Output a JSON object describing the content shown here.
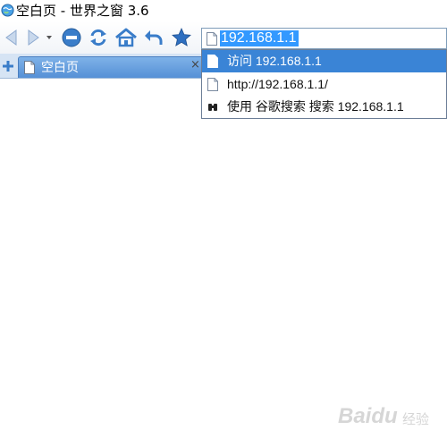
{
  "window": {
    "title": "空白页 - 世界之窗 3.6",
    "app_icon": "globe-icon"
  },
  "toolbar": {
    "buttons": [
      {
        "name": "back",
        "icon": "back-arrow-icon"
      },
      {
        "name": "forward",
        "icon": "forward-arrow-icon"
      },
      {
        "name": "history-dropdown",
        "icon": "chevron-down-icon"
      },
      {
        "name": "stop",
        "icon": "stop-icon"
      },
      {
        "name": "refresh",
        "icon": "refresh-icon"
      },
      {
        "name": "home",
        "icon": "home-icon"
      },
      {
        "name": "undo",
        "icon": "undo-arrow-icon"
      },
      {
        "name": "favorites",
        "icon": "star-icon"
      }
    ],
    "colors": {
      "icon_blue": "#3a7dc9",
      "star": "#2e6fc0"
    }
  },
  "address_bar": {
    "value": "192.168.1.1",
    "selected": true
  },
  "autocomplete": {
    "items": [
      {
        "label": "访问  192.168.1.1",
        "icon": "page-icon",
        "selected": true
      },
      {
        "label": "http://192.168.1.1/",
        "icon": "page-icon",
        "selected": false
      },
      {
        "label": "使用 谷歌搜索 搜索 192.168.1.1",
        "icon": "binoculars-icon",
        "selected": false
      }
    ]
  },
  "tabs": {
    "new_tab_icon": "plus-icon",
    "items": [
      {
        "title": "空白页",
        "icon": "page-icon",
        "close": "×"
      }
    ]
  },
  "watermark": {
    "text": "Baidu",
    "sub": "经验"
  }
}
